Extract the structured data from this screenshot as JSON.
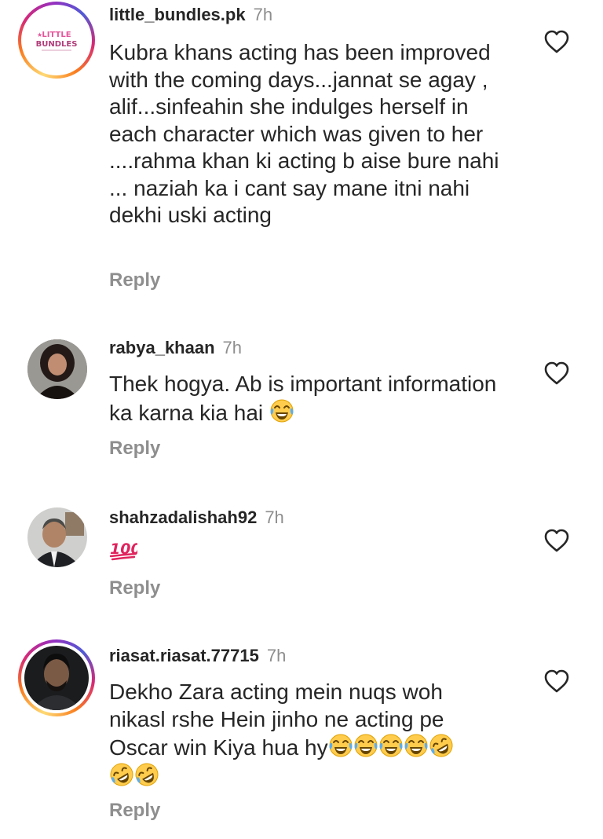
{
  "comments": [
    {
      "username": "little_bundles.pk",
      "time": "7h",
      "avatar_text": "LITTLE BUNDLES",
      "text": "Kubra khans acting has been improved with the coming days...jannat se agay , alif...sinfeahin she indulges herself in each character which was given to her ....rahma khan ki acting b aise bure nahi ... naziah ka i cant say mane itni nahi dekhi uski acting",
      "reply_label": "Reply"
    },
    {
      "username": "rabya_khaan",
      "time": "7h",
      "text": "Thek hogya. Ab is important information ka karna kia hai",
      "emojis": [
        "laughing-tears"
      ],
      "reply_label": "Reply"
    },
    {
      "username": "shahzadalishah92",
      "time": "7h",
      "text": "",
      "emojis": [
        "hundred-points"
      ],
      "reply_label": "Reply"
    },
    {
      "username": "riasat.riasat.77715",
      "time": "7h",
      "text": "Dekho Zara acting mein nuqs woh nikasl rshe Hein jinho ne acting pe Oscar win Kiya hua hy",
      "emojis": [
        "laughing-tears",
        "laughing-tears",
        "laughing-tears",
        "laughing-tears",
        "rolling-laughing",
        "rolling-laughing",
        "rolling-laughing"
      ],
      "reply_label": "Reply"
    }
  ],
  "colors": {
    "text": "#262626",
    "secondary": "#8e8e8e",
    "story_ring": [
      "#feda75",
      "#fa7e1e",
      "#d62976",
      "#962fbf",
      "#4f5bd5"
    ],
    "emoji_yellow": "#ffcc4d",
    "hundred_red": "#e0245e"
  },
  "icons": {
    "like": "heart-outline-icon"
  }
}
